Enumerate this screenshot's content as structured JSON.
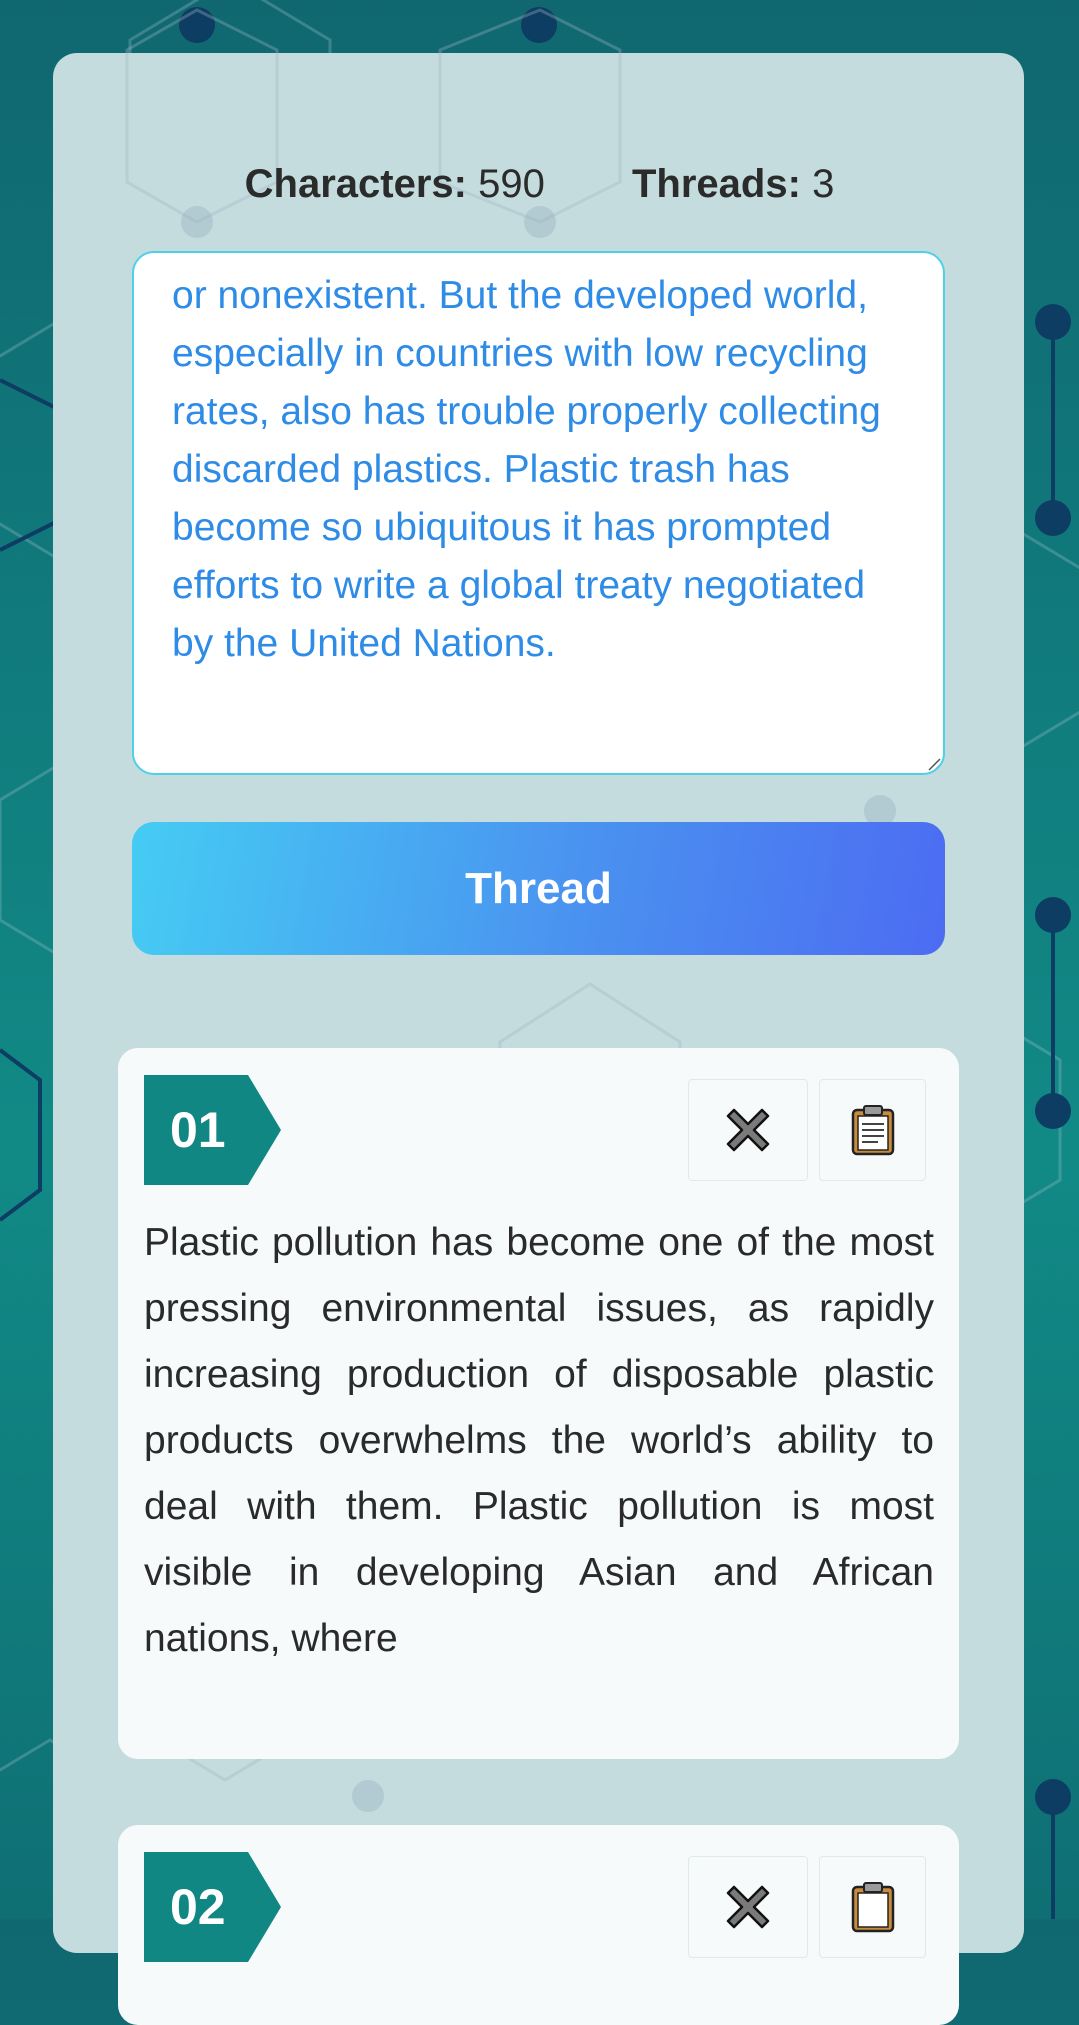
{
  "stats": {
    "characters_label": "Characters:",
    "characters_value": "590",
    "threads_label": "Threads:",
    "threads_value": "3"
  },
  "input": {
    "visible_text": "or nonexistent. But the developed world, especially in countries with low recycling rates, also has trouble properly collecting discarded plastics. Plastic trash has become so ubiquitous it has prompted efforts to write a global treaty negotiated by the United Nations."
  },
  "thread_button": {
    "label": "Thread"
  },
  "threads": [
    {
      "number": "01",
      "text": "Plastic pollution has become one of the most pressing environmental issues, as rapidly increasing production of disposable plastic products overwhelms the world’s ability to deal with them. Plastic pollution is most visible in developing Asian and African nations, where"
    },
    {
      "number": "02",
      "text": ""
    }
  ],
  "icons": {
    "delete": "close-x-icon",
    "copy": "clipboard-icon"
  },
  "colors": {
    "accent_teal": "#108782",
    "input_text": "#2f8ce6",
    "button_gradient_start": "#45ccf3",
    "button_gradient_end": "#4c6cf2",
    "panel_bg": "#c4dcde"
  }
}
